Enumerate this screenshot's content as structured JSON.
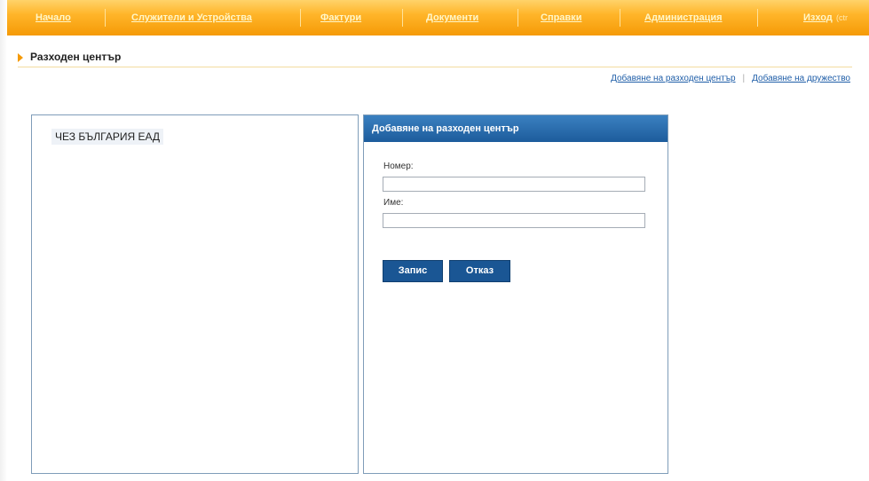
{
  "nav": {
    "items": [
      {
        "label": "Начало"
      },
      {
        "label": "Служители и Устройства"
      },
      {
        "label": "Фактури"
      },
      {
        "label": "Документи"
      },
      {
        "label": "Справки"
      },
      {
        "label": "Администрация"
      },
      {
        "label": "Изход"
      }
    ],
    "logout_extra": "(ctr"
  },
  "page": {
    "title": "Разходен център"
  },
  "actions": {
    "add_cost_center": "Добавяне на разходен център",
    "add_company": "Добавяне на дружество"
  },
  "tree": {
    "nodes": [
      {
        "label": "ЧЕЗ БЪЛГАРИЯ ЕАД"
      }
    ]
  },
  "form": {
    "title": "Добавяне на разходен център",
    "number_label": "Номер:",
    "number_value": "",
    "name_label": "Име:",
    "name_value": "",
    "save_label": "Запис",
    "cancel_label": "Отказ"
  },
  "colors": {
    "nav_background": "#f59a06",
    "panel_header": "#1d5c9c",
    "button": "#1a5694",
    "link": "#1f5ea8"
  }
}
